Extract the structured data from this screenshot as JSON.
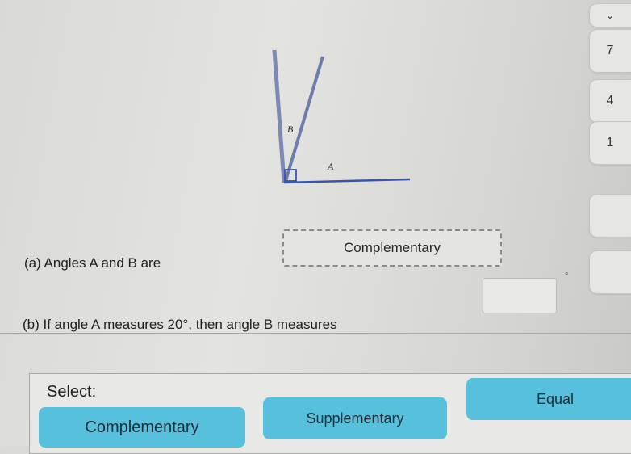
{
  "diagram": {
    "label_b": "B",
    "label_a": "A",
    "colors": {
      "ray": "#7d88b6",
      "baseline": "#3656a8",
      "right_angle": "#3656a8"
    }
  },
  "side_tabs": [
    {
      "label": "7"
    },
    {
      "label": "4"
    },
    {
      "label": "1"
    },
    {
      "label": ""
    },
    {
      "label": ""
    }
  ],
  "question_a": {
    "text": "(a) Angles A and B are",
    "answer": "Complementary"
  },
  "question_b": {
    "text": "(b) If angle A measures 20°, then angle B measures",
    "answer": "",
    "unit_mark": "°"
  },
  "select": {
    "label": "Select:",
    "options": [
      "Complementary",
      "Supplementary",
      "Equal"
    ]
  },
  "colors": {
    "choice_button": "#57c0dd",
    "panel": "#e8e8e5"
  }
}
